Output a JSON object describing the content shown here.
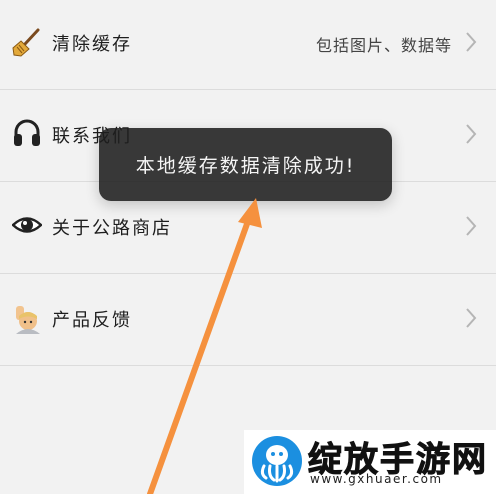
{
  "settings": {
    "items": [
      {
        "label": "清除缓存",
        "hint": "包括图片、数据等",
        "icon": "broom-icon"
      },
      {
        "label": "联系我们",
        "hint": "",
        "icon": "headphones-icon"
      },
      {
        "label": "关于公路商店",
        "hint": "",
        "icon": "eye-icon"
      },
      {
        "label": "产品反馈",
        "hint": "",
        "icon": "raised-hand-emoji-icon"
      }
    ]
  },
  "toast": {
    "message": "本地缓存数据清除成功!"
  },
  "annotation": {
    "arrow_color": "#f5913e"
  },
  "watermark": {
    "title": "绽放手游网",
    "url": "www.gxhuaer.com"
  }
}
